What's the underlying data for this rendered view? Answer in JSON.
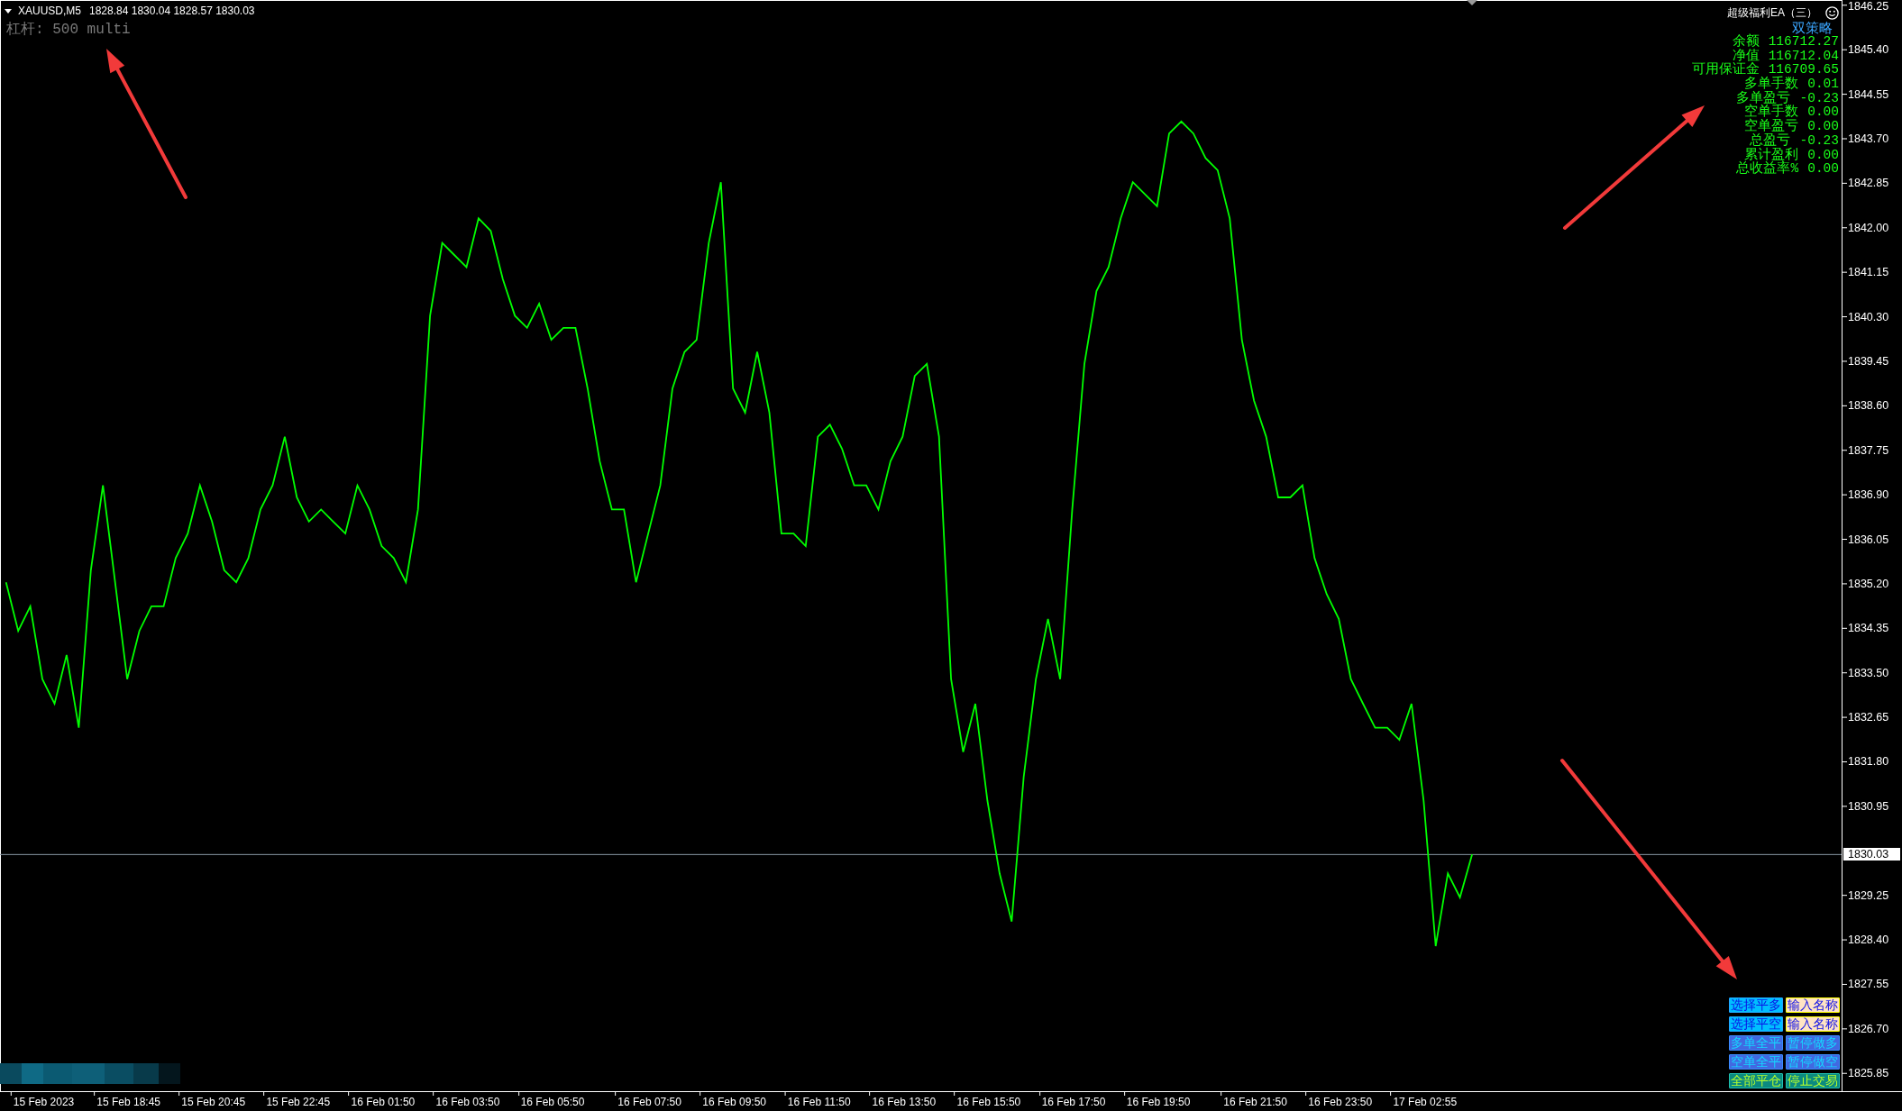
{
  "chart_header": {
    "symbol": "XAUUSD,M5",
    "ohlc": "1828.84 1830.04 1828.57 1830.03"
  },
  "leverage_label": "杠杆: 500 multi",
  "ea_panel": {
    "title": "超级福利EA（三）",
    "subtitle": "双策略",
    "stats": [
      {
        "label": "余额",
        "value": "116712.27"
      },
      {
        "label": "净值",
        "value": "116712.04"
      },
      {
        "label": "可用保证金",
        "value": "116709.65"
      },
      {
        "label": "多单手数",
        "value": "0.01"
      },
      {
        "label": "多单盈亏",
        "value": "-0.23"
      },
      {
        "label": "空单手数",
        "value": "0.00"
      },
      {
        "label": "空单盈亏",
        "value": "0.00"
      },
      {
        "label": "总盈亏",
        "value": "-0.23"
      },
      {
        "label": "累计盈利",
        "value": "0.00"
      },
      {
        "label": "总收益率%",
        "value": "0.00"
      }
    ]
  },
  "control_panel": {
    "rows": [
      [
        {
          "kind": "select",
          "label": "选择平多"
        },
        {
          "kind": "field",
          "value": "输入名称"
        }
      ],
      [
        {
          "kind": "select",
          "label": "选择平空"
        },
        {
          "kind": "field",
          "value": "输入名称"
        }
      ],
      [
        {
          "kind": "action",
          "label": "多单全平"
        },
        {
          "kind": "action",
          "label": "暂停做多"
        }
      ],
      [
        {
          "kind": "action",
          "label": "空单全平"
        },
        {
          "kind": "action",
          "label": "暂停做空"
        }
      ],
      [
        {
          "kind": "master",
          "label": "全部平仓"
        },
        {
          "kind": "master",
          "label": "停止交易"
        }
      ]
    ]
  },
  "chart": {
    "chart_data": {
      "type": "line",
      "categories": [
        null,
        null,
        null,
        "15 Feb 2023",
        null,
        null,
        null,
        null,
        null,
        null,
        "15 Feb 18:45",
        null,
        null,
        null,
        null,
        null,
        null,
        "15 Feb 20:45",
        null,
        null,
        null,
        null,
        null,
        null,
        "15 Feb 22:45",
        null,
        null,
        null,
        null,
        null,
        null,
        "16 Feb 01:50",
        null,
        null,
        null,
        null,
        null,
        null,
        "16 Feb 03:50",
        null,
        null,
        null,
        null,
        null,
        null,
        "16 Feb 05:50",
        null,
        null,
        null,
        null,
        null,
        null,
        null,
        "16 Feb 07:50",
        null,
        null,
        null,
        null,
        null,
        null,
        "16 Feb 09:50",
        null,
        null,
        null,
        null,
        null,
        null,
        "16 Feb 11:50",
        null,
        null,
        null,
        null,
        null,
        null,
        "16 Feb 13:50",
        null,
        null,
        null,
        null,
        null,
        null,
        "16 Feb 15:50",
        null,
        null,
        null,
        null,
        null,
        null,
        "16 Feb 17:50",
        null,
        null,
        null,
        null,
        null,
        null,
        "16 Feb 19:50",
        null,
        null,
        null,
        null,
        null,
        null,
        null,
        "16 Feb 21:50",
        null,
        null,
        null,
        null,
        null,
        null,
        "16 Feb 23:50",
        null,
        null,
        null,
        null,
        null,
        null,
        "17 Feb 02:55",
        null,
        null,
        null,
        null,
        null,
        null,
        null,
        null,
        null,
        null,
        null,
        null,
        null,
        null,
        null,
        null,
        null,
        null,
        null,
        null,
        null,
        null,
        null,
        null,
        null,
        null,
        null,
        null,
        null,
        null,
        null,
        null,
        null,
        null
      ],
      "series": [
        {
          "color": "#00ff00",
          "values": [
            1835.23,
            1834.3,
            1834.77,
            1833.38,
            1832.91,
            1833.84,
            1832.45,
            1835.46,
            1837.08,
            1835.23,
            1833.38,
            1834.3,
            1834.77,
            1834.77,
            1835.69,
            1836.16,
            1837.08,
            1836.39,
            1835.46,
            1835.23,
            1835.69,
            1836.62,
            1837.08,
            1838.01,
            1836.85,
            1836.39,
            1836.62,
            1836.39,
            1836.16,
            1837.08,
            1836.62,
            1835.92,
            1835.69,
            1835.23,
            1836.62,
            1840.32,
            1841.71,
            1841.48,
            1841.25,
            1842.18,
            1841.94,
            1841.02,
            1840.32,
            1840.09,
            1840.55,
            1839.86,
            1840.09,
            1840.09,
            1838.93,
            1837.54,
            1836.62,
            1836.62,
            1835.23,
            1836.16,
            1837.08,
            1838.93,
            1839.63,
            1839.86,
            1841.71,
            1842.87,
            1838.93,
            1838.47,
            1839.63,
            1838.47,
            1836.16,
            1836.16,
            1835.92,
            1838.01,
            1838.24,
            1837.78,
            1837.08,
            1837.08,
            1836.62,
            1837.54,
            1838.01,
            1839.17,
            1839.4,
            1838.01,
            1833.38,
            1831.99,
            1832.91,
            1831.06,
            1829.67,
            1828.75,
            1831.52,
            1833.38,
            1834.53,
            1833.38,
            1836.62,
            1839.4,
            1840.79,
            1841.25,
            1842.18,
            1842.87,
            1842.64,
            1842.41,
            1843.8,
            1844.03,
            1843.8,
            1843.33,
            1843.1,
            1842.18,
            1839.86,
            1838.7,
            1838.01,
            1836.85,
            1836.85,
            1837.08,
            1835.69,
            1835.0,
            1834.53,
            1833.38,
            1832.91,
            1832.45,
            1832.45,
            1832.22,
            1832.91,
            1831.06,
            1828.28,
            1829.67,
            1829.21,
            1830.03,
            null,
            null,
            null,
            null,
            null,
            null,
            null,
            null,
            null,
            null,
            null,
            null,
            null,
            null,
            null,
            null,
            null,
            null,
            null,
            null,
            null,
            null,
            null,
            null,
            null,
            null,
            null,
            null,
            null,
            null
          ]
        }
      ],
      "ylim": [
        1825.51,
        1846.35
      ],
      "yticks": [
        {
          "value": 1846.25,
          "label": "1846.25"
        },
        {
          "value": 1845.4,
          "label": "1845.40"
        },
        {
          "value": 1844.55,
          "label": "1844.55"
        },
        {
          "value": 1843.7,
          "label": "1843.70"
        },
        {
          "value": 1842.85,
          "label": "1842.85"
        },
        {
          "value": 1842.0,
          "label": "1842.00"
        },
        {
          "value": 1841.15,
          "label": "1841.15"
        },
        {
          "value": 1840.3,
          "label": "1840.30"
        },
        {
          "value": 1839.45,
          "label": "1839.45"
        },
        {
          "value": 1838.6,
          "label": "1838.60"
        },
        {
          "value": 1837.75,
          "label": "1837.75"
        },
        {
          "value": 1836.9,
          "label": "1836.90"
        },
        {
          "value": 1836.05,
          "label": "1836.05"
        },
        {
          "value": 1835.2,
          "label": "1835.20"
        },
        {
          "value": 1834.35,
          "label": "1834.35"
        },
        {
          "value": 1833.5,
          "label": "1833.50"
        },
        {
          "value": 1832.65,
          "label": "1832.65"
        },
        {
          "value": 1831.8,
          "label": "1831.80"
        },
        {
          "value": 1830.95,
          "label": "1830.95"
        },
        {
          "value": 1829.25,
          "label": "1829.25"
        },
        {
          "value": 1828.4,
          "label": "1828.40"
        },
        {
          "value": 1827.55,
          "label": "1827.55"
        },
        {
          "value": 1826.7,
          "label": "1826.70"
        },
        {
          "value": 1825.85,
          "label": "1825.85"
        }
      ],
      "ref_lines": [
        {
          "axis": "y",
          "value": 1830.03,
          "label": "1830.03"
        }
      ]
    }
  }
}
